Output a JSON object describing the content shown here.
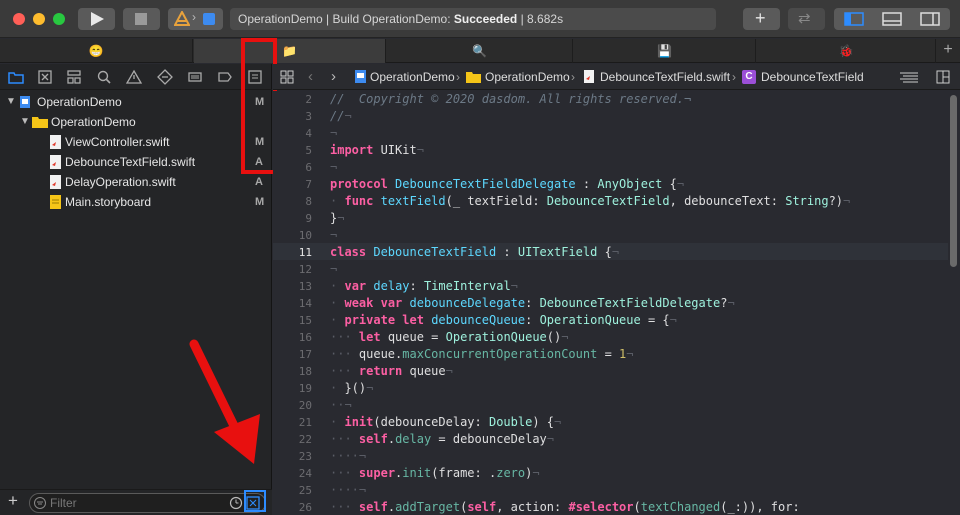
{
  "toolbar": {
    "activity_prefix": "OperationDemo | Build OperationDemo: ",
    "activity_status": "Succeeded",
    "activity_time": " | 8.682s"
  },
  "tabs": [
    "😁",
    "📁",
    "🔍",
    "💾",
    "🐞"
  ],
  "navigator": {
    "items": [
      {
        "label": "OperationDemo",
        "status": "M"
      },
      {
        "label": "OperationDemo",
        "status": ""
      },
      {
        "label": "ViewController.swift",
        "status": "M"
      },
      {
        "label": "DebounceTextField.swift",
        "status": "A"
      },
      {
        "label": "DelayOperation.swift",
        "status": "A"
      },
      {
        "label": "Main.storyboard",
        "status": "M"
      }
    ],
    "filter_placeholder": "Filter"
  },
  "jumpbar": {
    "project": "OperationDemo",
    "group": "OperationDemo",
    "file": "DebounceTextField.swift",
    "symbol": "DebounceTextField",
    "symbol_badge": "C"
  },
  "editor": {
    "current_line": 11,
    "line_numbers": [
      2,
      3,
      4,
      5,
      6,
      7,
      8,
      9,
      10,
      11,
      12,
      13,
      14,
      15,
      16,
      17,
      18,
      19,
      20,
      21,
      22,
      23,
      24,
      25,
      26
    ],
    "comment_line": "//  Copyright © 2020 dasdom. All rights reserved.¬"
  },
  "colors": {
    "keyword": "#fc5fa3",
    "type": "#5dd8ff",
    "comment": "#6c7986",
    "number": "#d0bf69",
    "annotation": "#e8100f",
    "accent": "#1e7cf0"
  }
}
